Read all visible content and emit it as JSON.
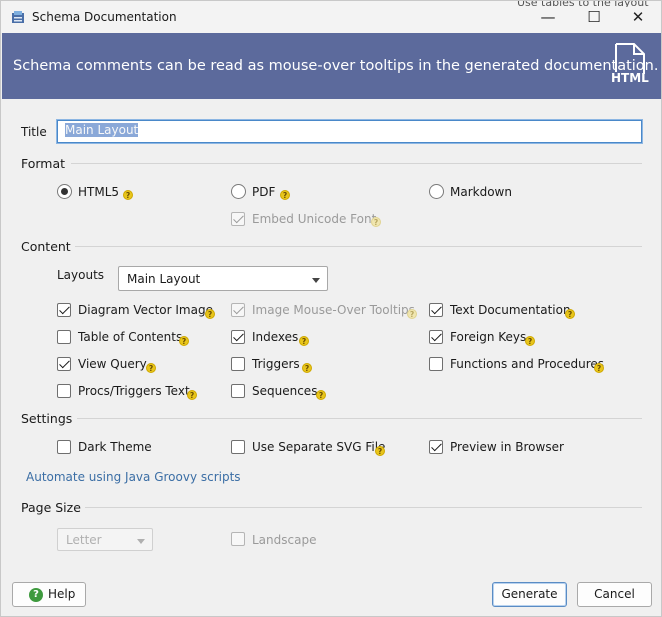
{
  "window": {
    "title": "Schema Documentation",
    "controls": {
      "minimize": "—",
      "maximize": "☐",
      "close": "✕"
    },
    "background_text": "Use tables to the layout"
  },
  "banner": {
    "text": "Schema comments can be read as mouse-over tooltips in the generated documentation.",
    "icon_label": "HTML",
    "color": "#5c6a9c"
  },
  "title_field": {
    "label": "Title",
    "value": "Main Layout"
  },
  "format": {
    "label": "Format",
    "options": [
      "HTML5",
      "PDF",
      "Markdown"
    ],
    "selected": "HTML5",
    "embed_unicode_font": {
      "label": "Embed Unicode Font",
      "checked": true,
      "enabled": false
    }
  },
  "content": {
    "label": "Content",
    "layouts_label": "Layouts",
    "layouts_value": "Main Layout",
    "checkboxes": [
      {
        "label": "Diagram Vector Image",
        "checked": true,
        "enabled": true
      },
      {
        "label": "Image Mouse-Over Tooltips",
        "checked": true,
        "enabled": false
      },
      {
        "label": "Text Documentation",
        "checked": true,
        "enabled": true
      },
      {
        "label": "Table of Contents",
        "checked": false,
        "enabled": true
      },
      {
        "label": "Indexes",
        "checked": true,
        "enabled": true
      },
      {
        "label": "Foreign Keys",
        "checked": true,
        "enabled": true
      },
      {
        "label": "View Query",
        "checked": true,
        "enabled": true
      },
      {
        "label": "Triggers",
        "checked": false,
        "enabled": true
      },
      {
        "label": "Functions and Procedures",
        "checked": false,
        "enabled": true
      },
      {
        "label": "Procs/Triggers Text",
        "checked": false,
        "enabled": true
      },
      {
        "label": "Sequences",
        "checked": false,
        "enabled": true
      }
    ]
  },
  "settings": {
    "label": "Settings",
    "checkboxes": [
      {
        "label": "Dark Theme",
        "checked": false
      },
      {
        "label": "Use Separate SVG File",
        "checked": false
      },
      {
        "label": "Preview in Browser",
        "checked": true
      }
    ],
    "automate_link": "Automate using Java Groovy scripts"
  },
  "page_size": {
    "label": "Page Size",
    "size_value": "Letter",
    "landscape": {
      "label": "Landscape",
      "checked": false,
      "enabled": false
    }
  },
  "buttons": {
    "help": "Help",
    "generate": "Generate",
    "cancel": "Cancel"
  },
  "help_marker": "?"
}
